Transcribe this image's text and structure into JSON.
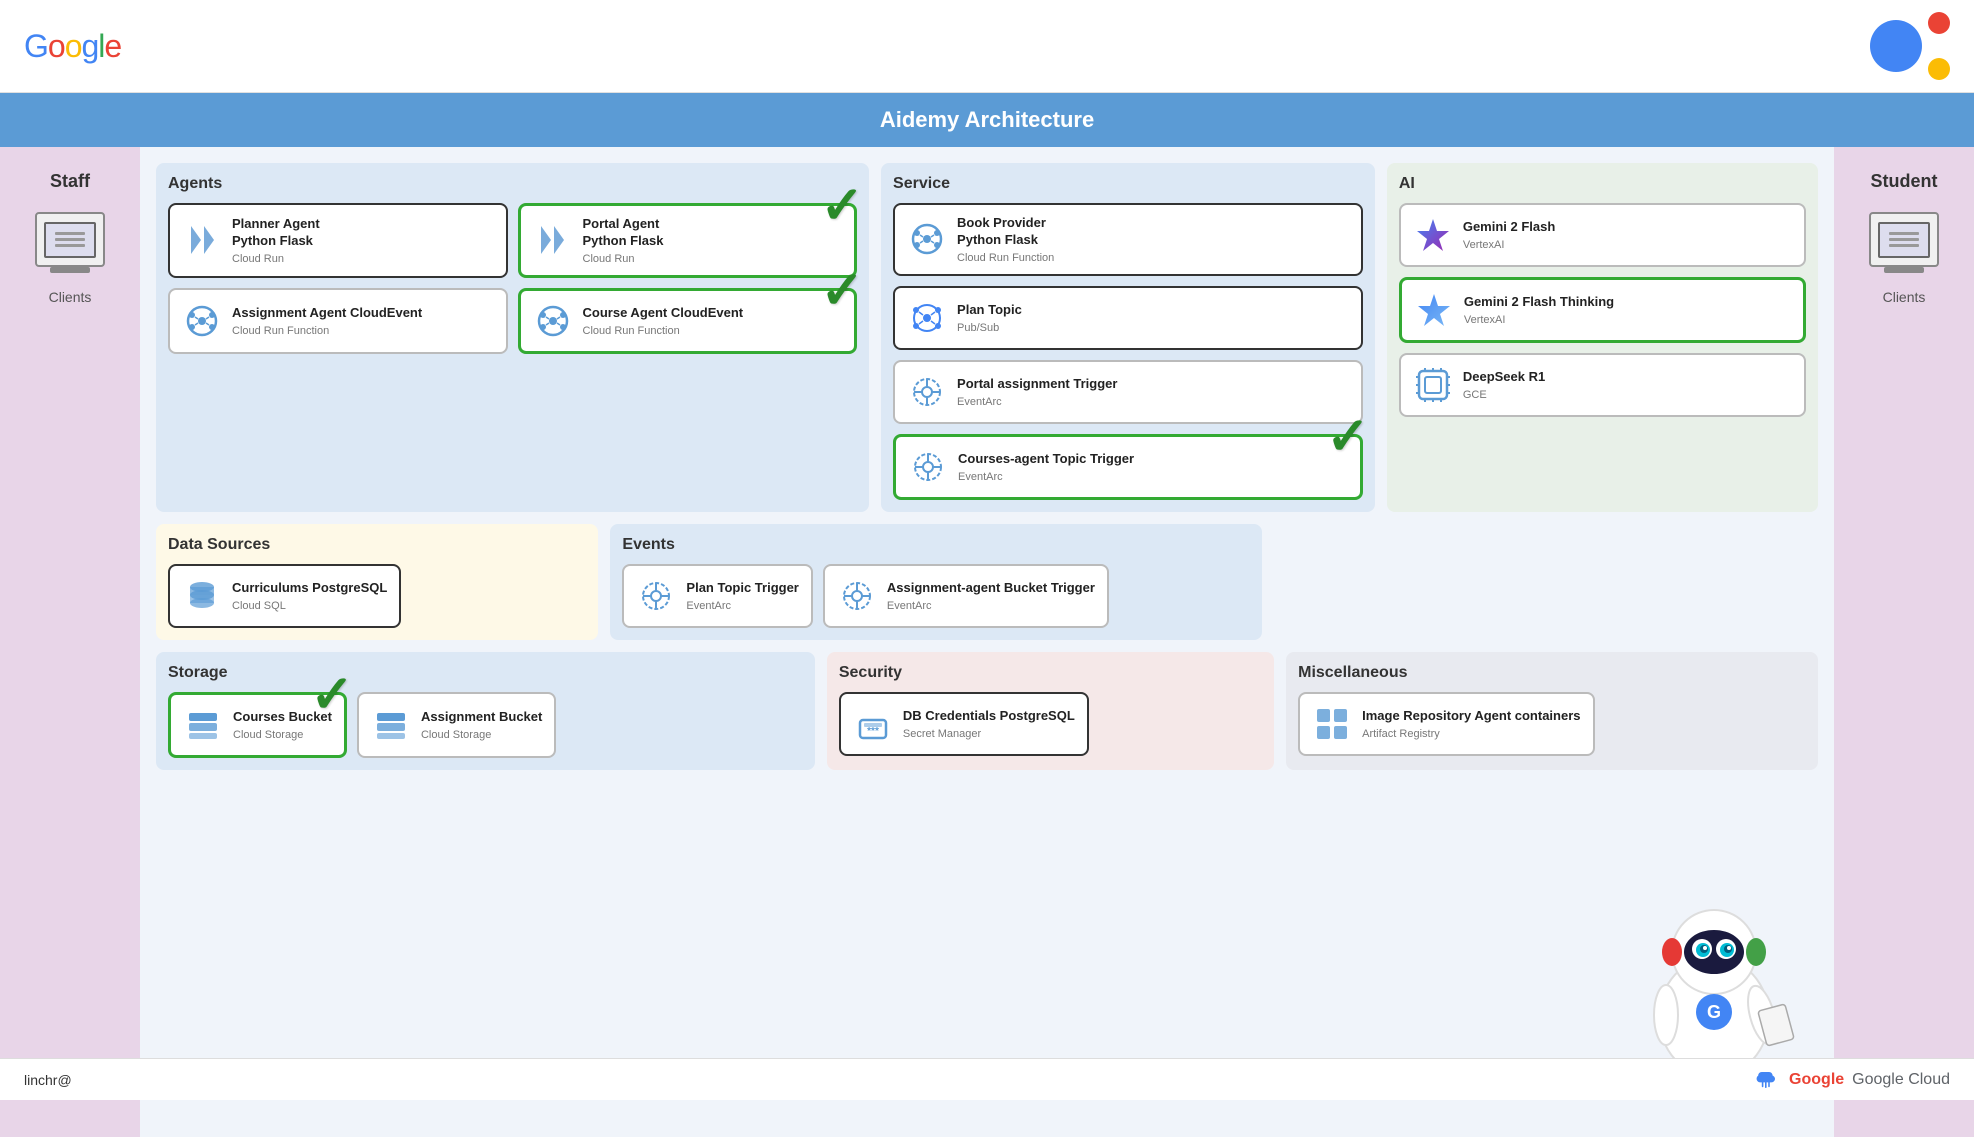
{
  "header": {
    "google_logo": "Google",
    "title": "Aidemy Architecture"
  },
  "sidebar_left": {
    "label": "Staff",
    "client_label": "Clients"
  },
  "sidebar_right": {
    "label": "Student",
    "client_label": "Clients"
  },
  "sections": {
    "agents": {
      "title": "Agents",
      "cards": [
        {
          "name": "planner-agent",
          "title": "Planner Agent Python Flask",
          "subtitle": "Cloud Run",
          "icon": "cloud-run",
          "border": "dark",
          "check": false
        },
        {
          "name": "portal-agent",
          "title": "Portal Agent Python Flask",
          "subtitle": "Cloud Run",
          "icon": "cloud-run",
          "border": "green",
          "check": true
        },
        {
          "name": "assignment-agent",
          "title": "Assignment Agent CloudEvent",
          "subtitle": "Cloud Run Function",
          "icon": "cloudevent",
          "border": "plain",
          "check": false
        },
        {
          "name": "course-agent",
          "title": "Course Agent CloudEvent",
          "subtitle": "Cloud Run Function",
          "icon": "cloudevent",
          "border": "green",
          "check": true
        }
      ]
    },
    "service": {
      "title": "Service",
      "cards": [
        {
          "name": "book-provider",
          "title": "Book Provider Python Flask",
          "subtitle": "Cloud Run Function",
          "icon": "cloudevent",
          "border": "dark",
          "check": false
        },
        {
          "name": "plan-topic",
          "title": "Plan Topic",
          "subtitle": "Pub/Sub",
          "icon": "pubsub",
          "border": "dark",
          "check": false
        },
        {
          "name": "portal-assignment-trigger",
          "title": "Portal assignment Trigger",
          "subtitle": "EventArc",
          "icon": "eventarc",
          "border": "plain",
          "check": false
        },
        {
          "name": "courses-agent-topic",
          "title": "Courses-agent Topic Trigger",
          "subtitle": "EventArc",
          "icon": "eventarc",
          "border": "green",
          "check": true
        }
      ]
    },
    "ai": {
      "title": "AI",
      "cards": [
        {
          "name": "gemini-flash",
          "title": "Gemini 2 Flash",
          "subtitle": "VertexAI",
          "icon": "gemini",
          "border": "plain",
          "check": false
        },
        {
          "name": "gemini-flash-thinking",
          "title": "Gemini 2 Flash Thinking",
          "subtitle": "VertexAI",
          "icon": "gemini",
          "border": "green",
          "check": false
        },
        {
          "name": "deepseek-r1",
          "title": "DeepSeek R1",
          "subtitle": "GCE",
          "icon": "chip",
          "border": "plain",
          "check": false
        }
      ]
    },
    "data_sources": {
      "title": "Data Sources",
      "cards": [
        {
          "name": "curriculums-postgresql",
          "title": "Curriculums PostgreSQL",
          "subtitle": "Cloud SQL",
          "icon": "sql",
          "border": "dark",
          "check": false
        }
      ]
    },
    "events": {
      "title": "Events",
      "cards": [
        {
          "name": "plan-topic-trigger",
          "title": "Plan Topic Trigger",
          "subtitle": "EventArc",
          "icon": "eventarc",
          "border": "plain",
          "check": false
        },
        {
          "name": "assignment-agent-bucket",
          "title": "Assignment-agent Bucket Trigger",
          "subtitle": "EventArc",
          "icon": "eventarc",
          "border": "plain",
          "check": false
        }
      ]
    },
    "storage": {
      "title": "Storage",
      "cards": [
        {
          "name": "courses-bucket",
          "title": "Courses Bucket",
          "subtitle": "Cloud Storage",
          "icon": "storage",
          "border": "green",
          "check": true
        },
        {
          "name": "assignment-bucket",
          "title": "Assignment Bucket",
          "subtitle": "Cloud Storage",
          "icon": "storage",
          "border": "plain",
          "check": false
        }
      ]
    },
    "security": {
      "title": "Security",
      "cards": [
        {
          "name": "db-credentials",
          "title": "DB Credentials PostgreSQL",
          "subtitle": "Secret Manager",
          "icon": "secret",
          "border": "dark",
          "check": false
        }
      ]
    },
    "misc": {
      "title": "Miscellaneous",
      "cards": [
        {
          "name": "image-repository",
          "title": "Image Repository Agent containers",
          "subtitle": "Artifact Registry",
          "icon": "artifact",
          "border": "plain",
          "check": false
        }
      ]
    }
  },
  "bottom": {
    "email": "linchr@",
    "gc_label": "Google Cloud"
  }
}
